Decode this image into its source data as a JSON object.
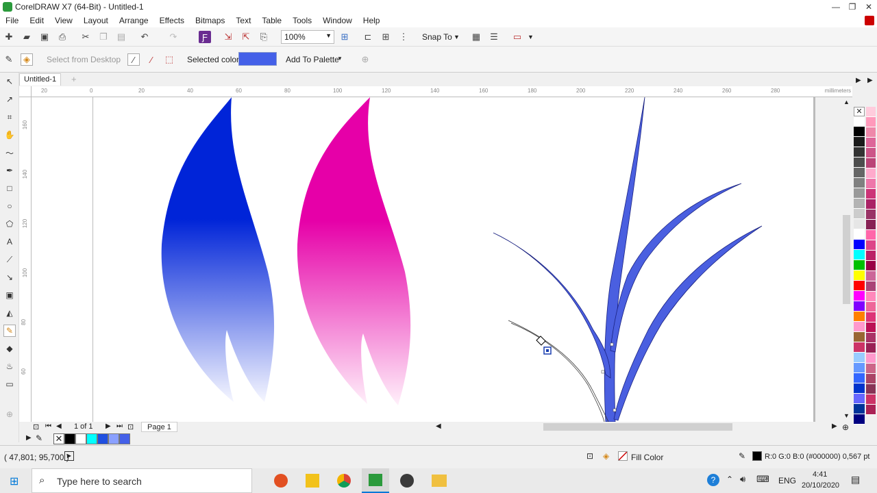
{
  "window": {
    "title": "CorelDRAW X7 (64-Bit) - Untitled-1",
    "minimize": "—",
    "restore": "❐",
    "close": "✕"
  },
  "menu": [
    "File",
    "Edit",
    "View",
    "Layout",
    "Arrange",
    "Effects",
    "Bitmaps",
    "Text",
    "Table",
    "Tools",
    "Window",
    "Help"
  ],
  "toolbar": {
    "zoom": "100%",
    "snap_to": "Snap To"
  },
  "propbar": {
    "select_from_desktop": "Select from Desktop",
    "selected_color_label": "Selected color",
    "selected_color": "#4460e8",
    "add_to_palette": "Add To Palette"
  },
  "document": {
    "tab": "Untitled-1"
  },
  "rulers": {
    "horizontal": [
      "20",
      "0",
      "20",
      "40",
      "60",
      "80",
      "100",
      "120",
      "140",
      "160",
      "180",
      "200",
      "220",
      "240",
      "260",
      "280"
    ],
    "unit": "millimeters",
    "vertical": [
      "160",
      "140",
      "120",
      "100",
      "80",
      "60"
    ]
  },
  "pagenav": {
    "counter": "1 of 1",
    "page_label": "Page 1"
  },
  "status": {
    "coords": "( 47,801; 95,700 )",
    "fill_label": "Fill Color",
    "outline": "R:0 G:0 B:0 (#000000)  0,567 pt"
  },
  "taskbar": {
    "search_placeholder": "Type here to search",
    "language": "ENG",
    "time": "4:41",
    "date": "20/10/2020"
  },
  "colors": {
    "blue_top": "#0024d8",
    "blue_bottom": "#f5f6ff",
    "pink_top": "#e600a8",
    "pink_bottom": "#fff0fa",
    "plant": "#4a5fe0"
  },
  "palette": [
    "#ffffff",
    "#000000",
    "#1a1a1a",
    "#333333",
    "#4d4d4d",
    "#666666",
    "#808080",
    "#999999",
    "#b3b3b3",
    "#cccccc",
    "#e6e6e6",
    "#ffffff",
    "#0000ff",
    "#00ffff",
    "#00c000",
    "#ffff00",
    "#ff0000",
    "#ff00ff",
    "#8000ff",
    "#ff8000",
    "#ff99cc",
    "#996633",
    "#cc3366",
    "#99ccff",
    "#6699ff",
    "#3366ff",
    "#0033cc",
    "#6666ff",
    "#003399",
    "#000080"
  ],
  "palette2": [
    "#ffccdd",
    "#ff99bb",
    "#ee88aa",
    "#dd6699",
    "#cc5588",
    "#bb4477",
    "#ffaacc",
    "#ee77aa",
    "#cc3377",
    "#aa2266",
    "#993366",
    "#882255",
    "#ff66aa",
    "#dd4488",
    "#bb2266",
    "#990044",
    "#cc6699",
    "#aa4477",
    "#ff88bb",
    "#ee6699",
    "#dd3377",
    "#bb1155",
    "#aa3366",
    "#992255",
    "#ff99cc",
    "#cc6688",
    "#aa4466",
    "#883355",
    "#cc3366",
    "#aa2255"
  ],
  "doc_palette": [
    "#000000",
    "#ffffff",
    "#00ffff",
    "#1f4fe0",
    "#8aa0ff",
    "#4460e8"
  ]
}
